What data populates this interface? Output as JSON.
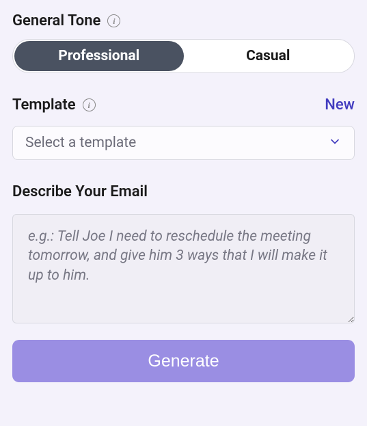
{
  "tone": {
    "label": "General Tone",
    "options": [
      "Professional",
      "Casual"
    ],
    "selected": "Professional"
  },
  "template": {
    "label": "Template",
    "new_link": "New",
    "placeholder": "Select a template",
    "selected": null
  },
  "describe": {
    "label": "Describe Your Email",
    "placeholder": "e.g.: Tell Joe I need to reschedule the meeting tomorrow, and give him 3 ways that I will make it up to him.",
    "value": ""
  },
  "actions": {
    "generate": "Generate"
  },
  "icons": {
    "info": "i"
  }
}
